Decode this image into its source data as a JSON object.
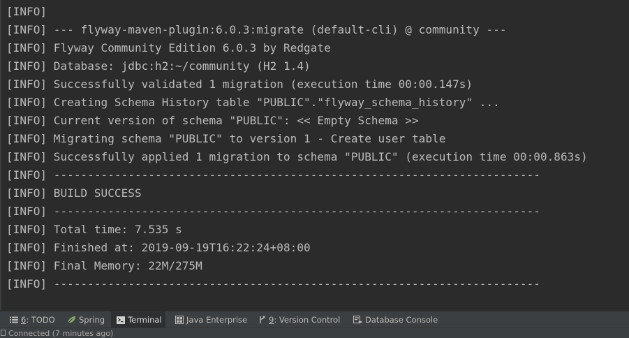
{
  "console": {
    "lines": [
      "[INFO]",
      "[INFO] --- flyway-maven-plugin:6.0.3:migrate (default-cli) @ community ---",
      "[INFO] Flyway Community Edition 6.0.3 by Redgate",
      "[INFO] Database: jdbc:h2:~/community (H2 1.4)",
      "[INFO] Successfully validated 1 migration (execution time 00:00.147s)",
      "[INFO] Creating Schema History table \"PUBLIC\".\"flyway_schema_history\" ...",
      "[INFO] Current version of schema \"PUBLIC\": << Empty Schema >>",
      "[INFO] Migrating schema \"PUBLIC\" to version 1 - Create user table",
      "[INFO] Successfully applied 1 migration to schema \"PUBLIC\" (execution time 00:00.863s)",
      "[INFO] ------------------------------------------------------------------------",
      "[INFO] BUILD SUCCESS",
      "[INFO] ------------------------------------------------------------------------",
      "[INFO] Total time: 7.535 s",
      "[INFO] Finished at: 2019-09-19T16:22:24+08:00",
      "[INFO] Final Memory: 22M/275M",
      "[INFO] ------------------------------------------------------------------------"
    ]
  },
  "tool_windows": {
    "todo": {
      "mnemonic": "6",
      "label": ": TODO",
      "icon": "list-icon"
    },
    "spring": {
      "label": "Spring",
      "icon": "spring-leaf-icon"
    },
    "terminal": {
      "label": "Terminal",
      "icon": "terminal-icon",
      "active": true
    },
    "java_enterprise": {
      "label": "Java Enterprise",
      "icon": "java-enterprise-icon"
    },
    "version_control": {
      "mnemonic": "9",
      "label": ": Version Control",
      "icon": "branch-icon"
    },
    "database_console": {
      "label": "Database Console",
      "icon": "database-console-icon"
    }
  },
  "status_bar": {
    "message": "Connected (7 minutes ago)"
  },
  "colors": {
    "console_bg": "#2b2b2b",
    "console_text": "#bbbbbb",
    "toolbar_bg": "#3c3f41",
    "active_tab_bg": "#2d2f30"
  }
}
